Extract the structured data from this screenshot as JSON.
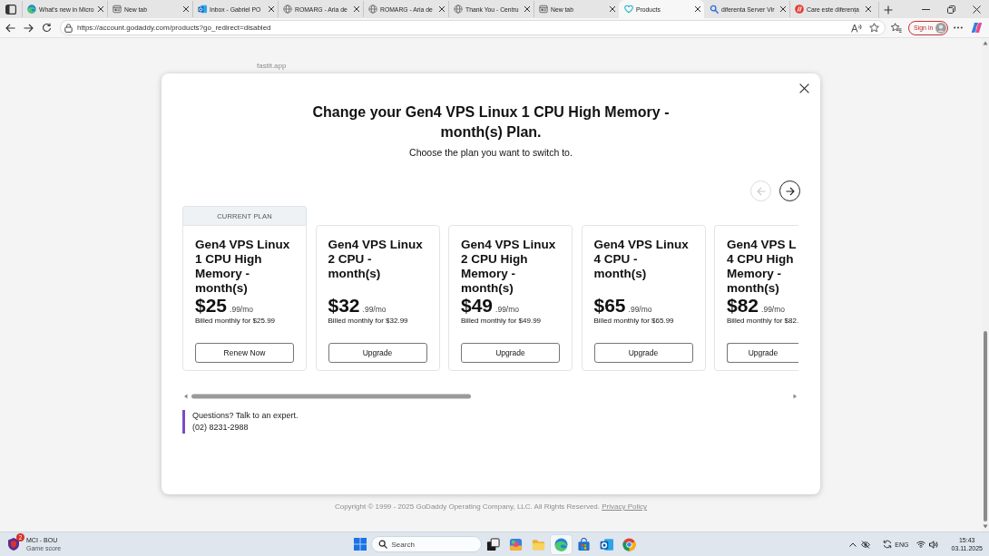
{
  "browser": {
    "tabs": [
      {
        "title": "What's new in Micro",
        "kind": "edge",
        "selected": false
      },
      {
        "title": "New tab",
        "kind": "page",
        "selected": false
      },
      {
        "title": "Inbox - Gabriel PO",
        "kind": "mail",
        "selected": false
      },
      {
        "title": "ROMARG - Aria de",
        "kind": "globe",
        "selected": false
      },
      {
        "title": "ROMARG - Aria de",
        "kind": "globe",
        "selected": false
      },
      {
        "title": "Thank You - Centru",
        "kind": "globe",
        "selected": false
      },
      {
        "title": "New tab",
        "kind": "page",
        "selected": false
      },
      {
        "title": "Products",
        "kind": "heart",
        "selected": true
      },
      {
        "title": "diferenta Server Vir",
        "kind": "search",
        "selected": false
      },
      {
        "title": "Care este diferența",
        "kind": "slash",
        "selected": false
      }
    ],
    "address": "https://account.godaddy.com/products?go_redirect=disabled",
    "sign_in": "Sign in"
  },
  "page": {
    "background_text": "fastit.app",
    "copyright": "Copyright © 1999 - 2025 GoDaddy Operating Company, LLC. All Rights Reserved.",
    "privacy_link": "Privacy Policy"
  },
  "modal": {
    "title": "Change your Gen4 VPS Linux 1 CPU High Memory - month(s) Plan.",
    "subtitle": "Choose the plan you want to switch to.",
    "nav": [
      {
        "kind": "previous",
        "disabled": true
      },
      {
        "kind": "next",
        "disabled": false
      }
    ],
    "plans": [
      {
        "name": "Gen4 VPS Linux 1 CPU High Memory - month(s)",
        "current": true,
        "badge": "CURRENT PLAN",
        "price": "$25",
        "price_suffix": ".99/mo",
        "billing": "Billed monthly for $25.99",
        "button": "Renew Now"
      },
      {
        "name": "Gen4 VPS Linux 2 CPU - month(s)",
        "current": false,
        "price": "$32",
        "price_suffix": ".99/mo",
        "billing": "Billed monthly for $32.99",
        "button": "Upgrade"
      },
      {
        "name": "Gen4 VPS Linux 2 CPU High Memory - month(s)",
        "current": false,
        "price": "$49",
        "price_suffix": ".99/mo",
        "billing": "Billed monthly for $49.99",
        "button": "Upgrade"
      },
      {
        "name": "Gen4 VPS Linux 4 CPU - month(s)",
        "current": false,
        "price": "$65",
        "price_suffix": ".99/mo",
        "billing": "Billed monthly for $65.99",
        "button": "Upgrade"
      },
      {
        "name": "Gen4 VPS L\n4 CPU High\nMemory -\nmonth(s)",
        "current": false,
        "price": "$82",
        "price_suffix": ".99/mo",
        "billing": "Billed monthly for $82.",
        "button": "Upgrade"
      }
    ],
    "contact": {
      "question": "Questions? Talk to an expert.",
      "phone": "(02) 8231-2988"
    }
  },
  "taskbar": {
    "widget": {
      "title": "MCI - BOU",
      "subtitle": "Game score",
      "badge": "2"
    },
    "search": {
      "placeholder": "Search"
    },
    "apps": [
      {
        "kind": "taskview",
        "selected": false
      },
      {
        "kind": "office",
        "selected": false
      },
      {
        "kind": "folder",
        "selected": false
      },
      {
        "kind": "edge",
        "selected": true
      },
      {
        "kind": "store",
        "selected": false
      },
      {
        "kind": "mail",
        "selected": false
      },
      {
        "kind": "chrome",
        "selected": false
      }
    ],
    "language": "ENG",
    "time": "15:43",
    "date": "03.11.2025"
  }
}
